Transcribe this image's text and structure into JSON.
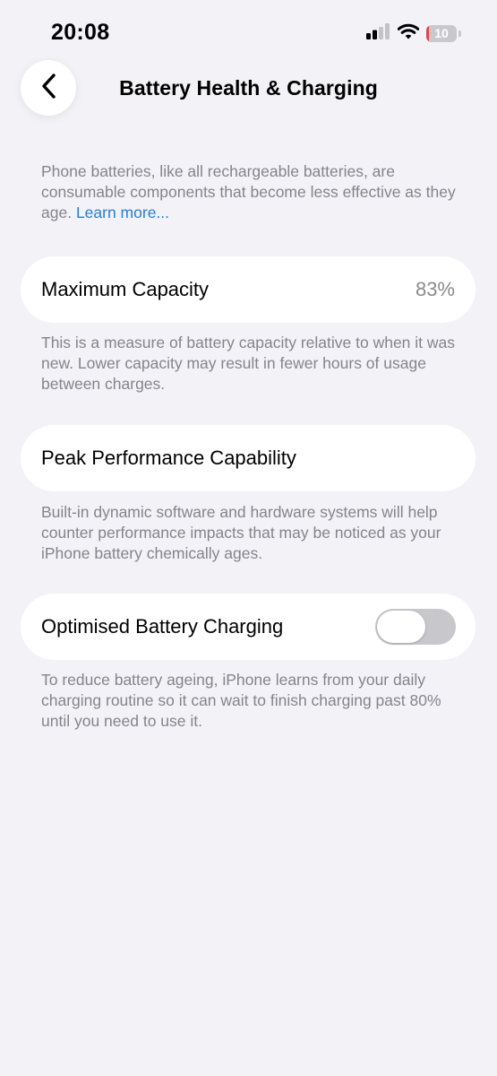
{
  "status_bar": {
    "time": "20:08",
    "battery_level": "10",
    "battery_fraction": 0.1,
    "battery_color": "#e0474c",
    "icons": [
      "cellular-signal-icon",
      "wifi-icon",
      "battery-icon"
    ]
  },
  "nav": {
    "back_icon": "chevron-left-icon",
    "title": "Battery Health & Charging"
  },
  "intro": {
    "text": "Phone batteries, like all rechargeable batteries, are consumable components that become less effective as they age. ",
    "link": "Learn more..."
  },
  "maximum_capacity": {
    "label": "Maximum Capacity",
    "value": "83%",
    "footnote": "This is a measure of battery capacity relative to when it was new. Lower capacity may result in fewer hours of usage between charges."
  },
  "peak_performance": {
    "label": "Peak Performance Capability",
    "footnote": "Built-in dynamic software and hardware systems will help counter performance impacts that may be noticed as your iPhone battery chemically ages."
  },
  "optimised_charging": {
    "label": "Optimised Battery Charging",
    "enabled": false,
    "footnote": "To reduce battery ageing, iPhone learns from your daily charging routine so it can wait to finish charging past 80% until you need to use it."
  },
  "colors": {
    "background": "#f2f2f7",
    "link": "#2a7ed2",
    "secondary_text": "#84848a",
    "toggle_off": "#c7c7cc"
  }
}
